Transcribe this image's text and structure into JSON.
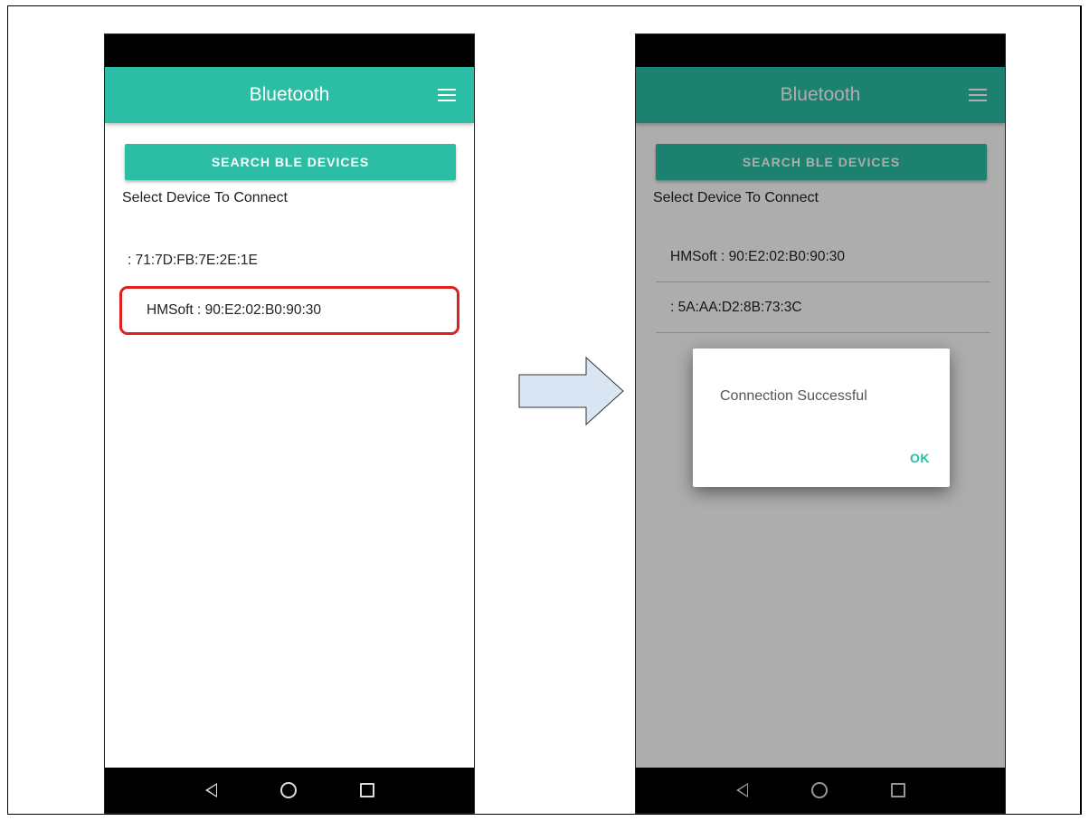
{
  "left_screen": {
    "app_title": "Bluetooth",
    "search_button": "SEARCH BLE DEVICES",
    "select_label": "Select Device To Connect",
    "devices": [
      {
        "label": ": 71:7D:FB:7E:2E:1E"
      },
      {
        "label": "HMSoft : 90:E2:02:B0:90:30"
      }
    ]
  },
  "right_screen": {
    "app_title": "Bluetooth",
    "search_button": "SEARCH BLE DEVICES",
    "select_label": "Select Device To Connect",
    "devices": [
      {
        "label": "HMSoft : 90:E2:02:B0:90:30"
      },
      {
        "label": ": 5A:AA:D2:8B:73:3C"
      }
    ],
    "dialog": {
      "message": "Connection Successful",
      "ok_label": "OK"
    }
  },
  "colors": {
    "accent": "#2bbea5",
    "highlight": "#e0201e",
    "arrow_fill": "#d9e5f3"
  },
  "icons": [
    "menu-icon",
    "nav-back-icon",
    "nav-home-icon",
    "nav-recent-icon",
    "right-arrow-icon"
  ]
}
